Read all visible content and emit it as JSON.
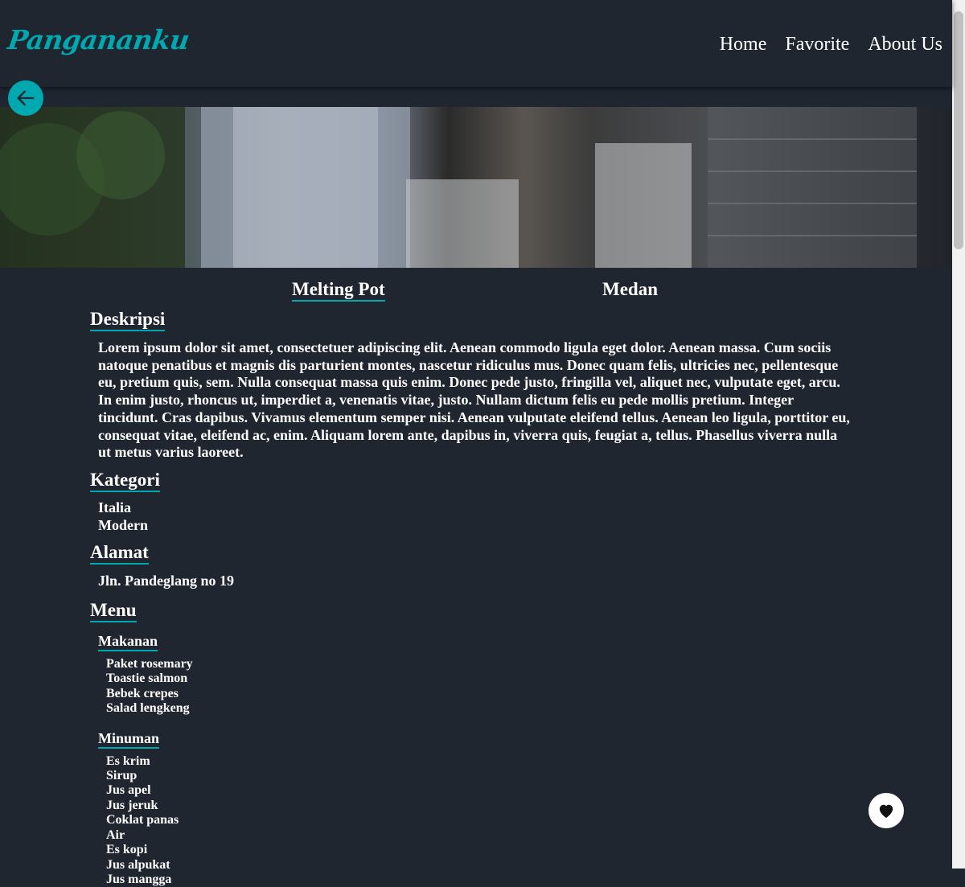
{
  "header": {
    "brand": "Pangananku",
    "nav": [
      {
        "label": "Home"
      },
      {
        "label": "Favorite"
      },
      {
        "label": "About Us"
      }
    ]
  },
  "icons": {
    "back": "arrow-left-icon",
    "favorite": "heart-icon"
  },
  "colors": {
    "accent": "#00a8b0",
    "background": "#202630",
    "text": "#ffffff"
  },
  "restaurant": {
    "name": "Melting Pot",
    "city": "Medan",
    "description_heading": "Deskripsi",
    "description": "Lorem ipsum dolor sit amet, consectetuer adipiscing elit. Aenean commodo ligula eget dolor. Aenean massa. Cum sociis natoque penatibus et magnis dis parturient montes, nascetur ridiculus mus. Donec quam felis, ultricies nec, pellentesque eu, pretium quis, sem. Nulla consequat massa quis enim. Donec pede justo, fringilla vel, aliquet nec, vulputate eget, arcu. In enim justo, rhoncus ut, imperdiet a, venenatis vitae, justo. Nullam dictum felis eu pede mollis pretium. Integer tincidunt. Cras dapibus. Vivamus elementum semper nisi. Aenean vulputate eleifend tellus. Aenean leo ligula, porttitor eu, consequat vitae, eleifend ac, enim. Aliquam lorem ante, dapibus in, viverra quis, feugiat a, tellus. Phasellus viverra nulla ut metus varius laoreet.",
    "category_heading": "Kategori",
    "categories": [
      "Italia",
      "Modern"
    ],
    "address_heading": "Alamat",
    "address": "Jln. Pandeglang no 19",
    "menu_heading": "Menu",
    "foods_heading": "Makanan",
    "foods": [
      "Paket rosemary",
      "Toastie salmon",
      "Bebek crepes",
      "Salad lengkeng"
    ],
    "drinks_heading": "Minuman",
    "drinks": [
      "Es krim",
      "Sirup",
      "Jus apel",
      "Jus jeruk",
      "Coklat panas",
      "Air",
      "Es kopi",
      "Jus alpukat",
      "Jus mangga"
    ]
  }
}
